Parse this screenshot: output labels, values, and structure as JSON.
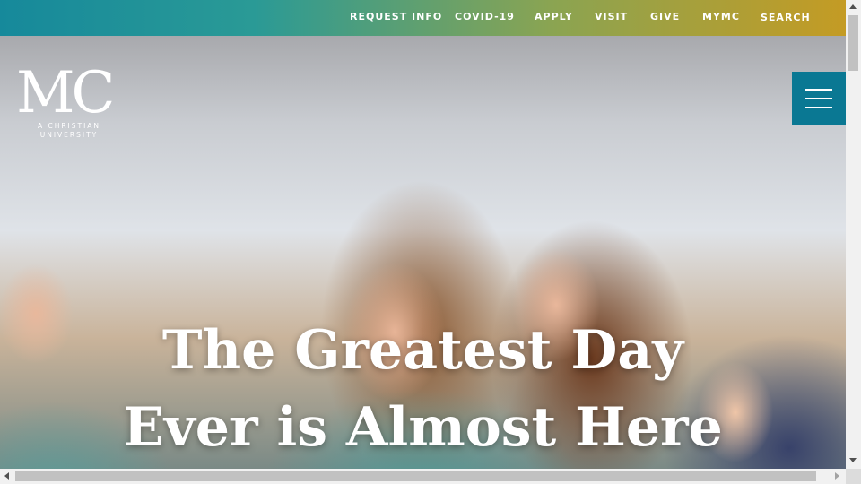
{
  "top_nav": {
    "items": [
      {
        "label": "REQUEST INFO"
      },
      {
        "label": "COVID-19"
      },
      {
        "label": "APPLY"
      },
      {
        "label": "VISIT"
      },
      {
        "label": "GIVE"
      },
      {
        "label": "MYMC"
      },
      {
        "label": "SEARCH"
      }
    ]
  },
  "logo": {
    "mark": "MC",
    "tagline_line1": "A CHRISTIAN",
    "tagline_line2": "UNIVERSITY"
  },
  "menu": {
    "icon": "hamburger-menu-icon"
  },
  "hero": {
    "headline_line1": "The Greatest Day",
    "headline_line2": "Ever is Almost Here"
  },
  "colors": {
    "topbar_start": "#16899b",
    "topbar_end": "#c49b24",
    "menu_button": "#0a7893"
  }
}
